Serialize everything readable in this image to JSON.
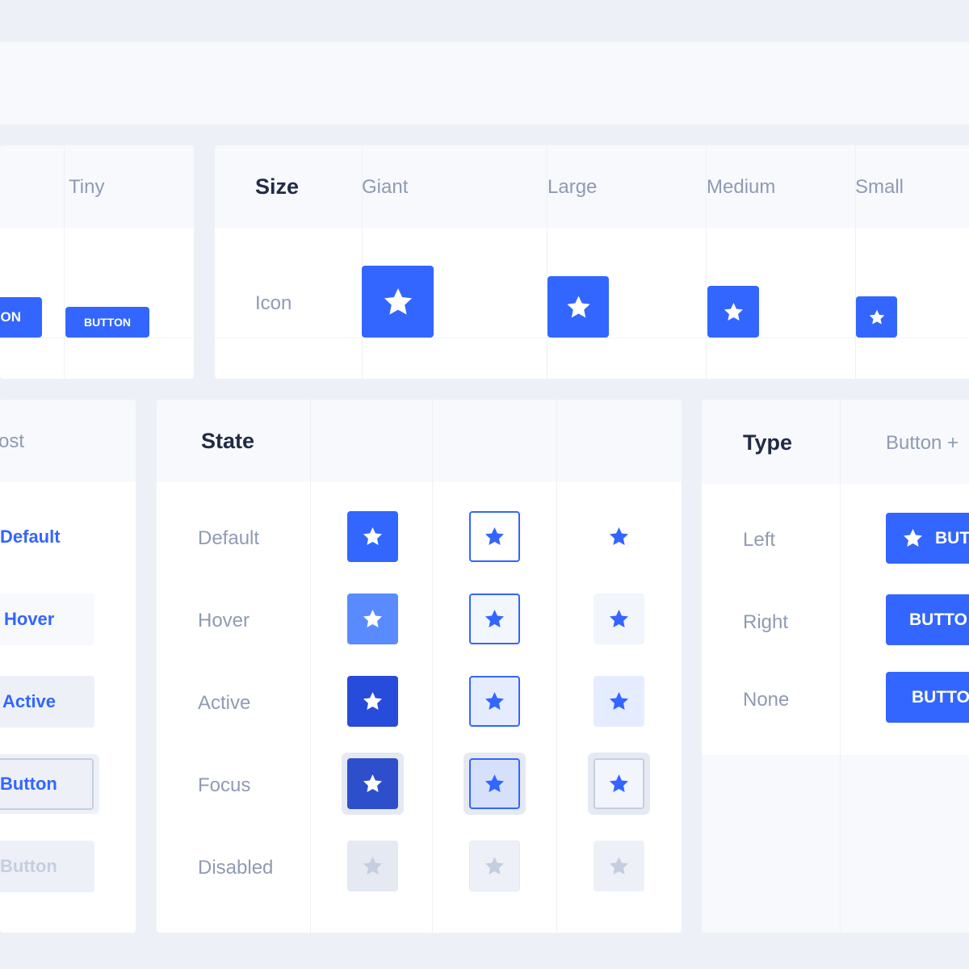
{
  "colors": {
    "primary": "#3366ff",
    "primary_hover": "#598bff",
    "primary_active": "#274bdb",
    "primary_focus": "#2e4fcc",
    "disabled_bg": "#e4e9f2",
    "disabled_icon": "#c5cee0",
    "background": "#edf1f7",
    "header_bg": "#f7f9fc",
    "heading_text": "#222b45",
    "label_text": "#8f9bb3"
  },
  "icons": {
    "star": "star-icon"
  },
  "size_left_panel": {
    "header_label": "Tiny",
    "partial_button_label": "ON",
    "tiny_button_label": "BUTTON"
  },
  "size_panel": {
    "title": "Size",
    "columns": [
      "Giant",
      "Large",
      "Medium",
      "Small"
    ],
    "row_label": "Icon"
  },
  "ghost_panel": {
    "header_label": "ost",
    "buttons": [
      "Default",
      "Hover",
      "Active",
      "Button",
      "Button"
    ]
  },
  "state_panel": {
    "title": "State",
    "rows": [
      "Default",
      "Hover",
      "Active",
      "Focus",
      "Disabled"
    ]
  },
  "type_panel": {
    "title": "Type",
    "header_label": "Button +",
    "rows": [
      "Left",
      "Right",
      "None"
    ],
    "left_button_label": "BUT",
    "right_button_label": "BUTTO",
    "none_button_label": "BUTTO"
  }
}
